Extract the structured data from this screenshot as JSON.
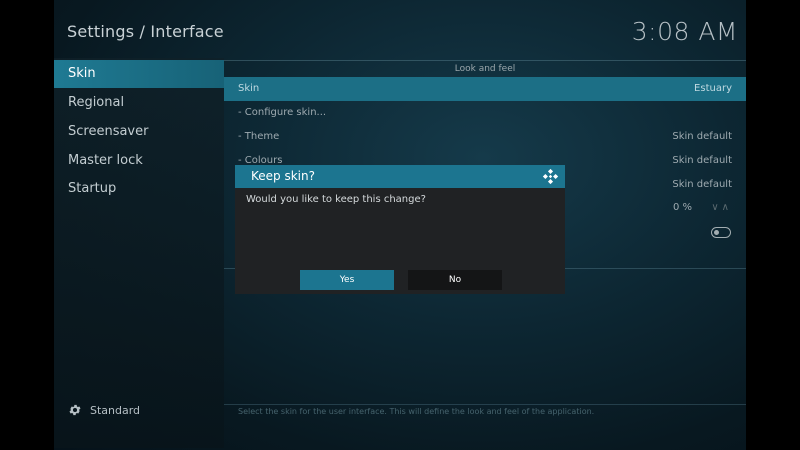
{
  "header": {
    "title": "Settings / Interface",
    "clock": "3:08 AM"
  },
  "sidebar": {
    "items": [
      {
        "label": "Skin",
        "active": true
      },
      {
        "label": "Regional"
      },
      {
        "label": "Screensaver"
      },
      {
        "label": "Master lock"
      },
      {
        "label": "Startup"
      }
    ],
    "settings_level": "Standard"
  },
  "main": {
    "section_title": "Look and feel",
    "rows": [
      {
        "label": "Skin",
        "value": "Estuary"
      },
      {
        "label": "- Configure skin...",
        "value": ""
      },
      {
        "label": "- Theme",
        "value": "Skin default"
      },
      {
        "label": "- Colours",
        "value": "Skin default"
      },
      {
        "label": "",
        "value": "Skin default"
      },
      {
        "label": "",
        "value": "0 %"
      }
    ],
    "footer_help": "Select the skin for the user interface. This will define the look and feel of the application."
  },
  "dialog": {
    "title": "Keep skin?",
    "message": "Would you like to keep this change?",
    "yes_label": "Yes",
    "no_label": "No"
  },
  "colors": {
    "accent": "#1c7590",
    "dialog_bg": "#202224"
  }
}
